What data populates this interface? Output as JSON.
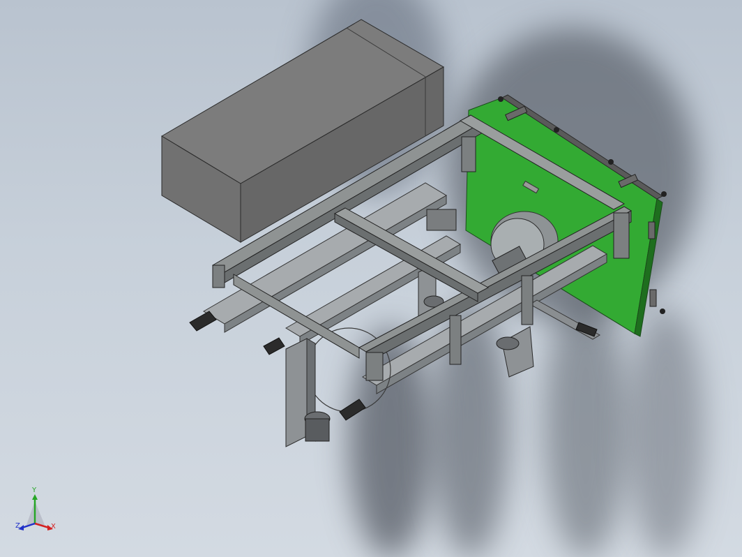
{
  "viewport": {
    "background": "#c5ced8",
    "part_colors": {
      "cabinet_top": "#7a7a7a",
      "cabinet_front": "#6b6b6b",
      "cabinet_side": "#5e5e5e",
      "frame": "#8c8f8f",
      "frame_dark": "#5a5d5f",
      "rail": "#a3a7aa",
      "green_panel": "#2fa82f",
      "green_dark": "#1f7a1f",
      "motor": "#2c2c2c"
    }
  },
  "triad": {
    "y_label": "Y",
    "x_label": "X",
    "z_label": "Z",
    "y_color": "#26a626",
    "x_color": "#d42020",
    "z_color": "#2030c8"
  }
}
